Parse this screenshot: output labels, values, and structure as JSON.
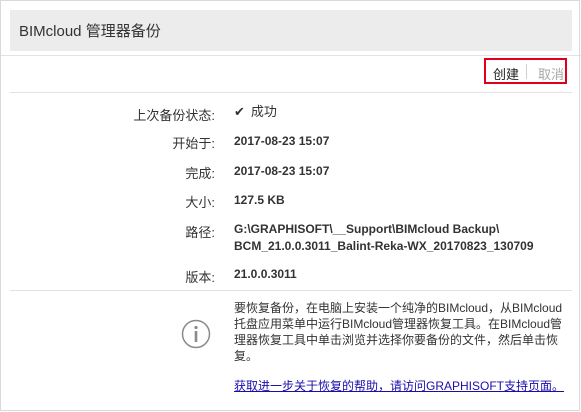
{
  "window": {
    "title": "BIMcloud 管理器备份"
  },
  "toolbar": {
    "create_label": "创建",
    "cancel_label": "取消"
  },
  "details": {
    "status_label": "上次备份状态:",
    "status_icon": "checkmark-icon",
    "status_value": "成功",
    "start_label": "开始于:",
    "start_value": "2017-08-23 15:07",
    "complete_label": "完成:",
    "complete_value": "2017-08-23 15:07",
    "size_label": "大小:",
    "size_value": "127.5 KB",
    "path_label": "路径:",
    "path_line1": "G:\\GRAPHISOFT\\__Support\\BIMcloud Backup\\",
    "path_line2": "BCM_21.0.0.3011_Balint-Reka-WX_20170823_130709",
    "version_label": "版本:",
    "version_value": "21.0.0.3011"
  },
  "info": {
    "icon": "info-icon",
    "text": "要恢复备份，在电脑上安装一个纯净的BIMcloud，从BIMcloud托盘应用菜单中运行BIMcloud管理器恢复工具。在BIMcloud管理器恢复工具中单击浏览并选择你要备份的文件，然后单击恢复。",
    "link_text": "获取进一步关于恢复的帮助，请访问GRAPHISOFT支持页面。"
  },
  "colors": {
    "header_bg": "#ececec",
    "highlight_border": "#e0001b",
    "link": "#1a0dab",
    "disabled_text": "#a8a8a8"
  }
}
